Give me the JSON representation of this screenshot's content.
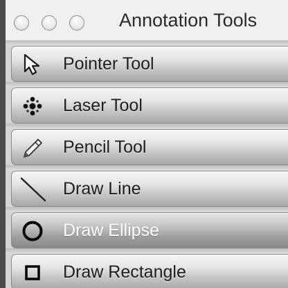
{
  "window": {
    "title": "Annotation Tools",
    "controls": [
      "close-button",
      "minimize-button",
      "zoom-button"
    ]
  },
  "tools": [
    {
      "label": "Pointer Tool",
      "icon": "pointer-arrow-icon",
      "selected": false
    },
    {
      "label": "Laser Tool",
      "icon": "laser-dots-icon",
      "selected": false
    },
    {
      "label": "Pencil Tool",
      "icon": "pencil-icon",
      "selected": false
    },
    {
      "label": "Draw Line",
      "icon": "diagonal-line-icon",
      "selected": false
    },
    {
      "label": "Draw Ellipse",
      "icon": "ellipse-icon",
      "selected": true
    },
    {
      "label": "Draw Rectangle",
      "icon": "rectangle-icon",
      "selected": false
    }
  ],
  "colors": {
    "title_text": "#2a2a2a",
    "label_text": "#1e1e1e",
    "selected_label_text": "#ffffff",
    "window_edge": "#4a4a4a"
  }
}
